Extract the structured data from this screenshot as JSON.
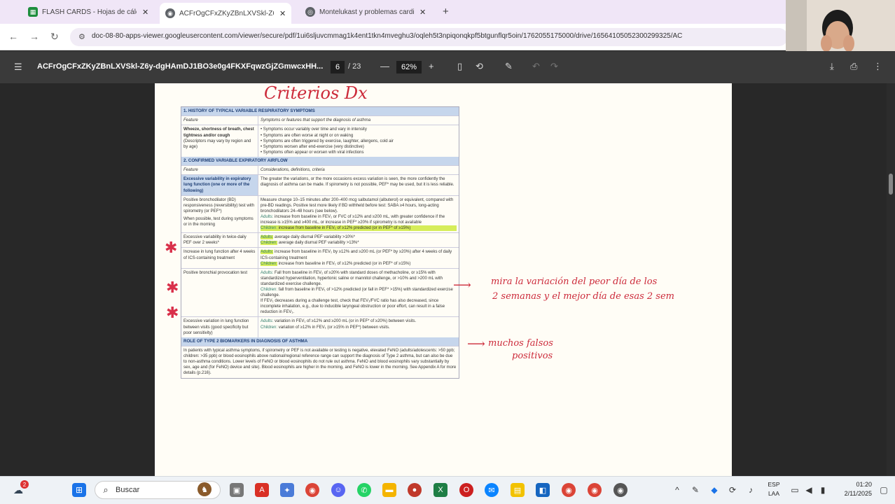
{
  "tabs": [
    {
      "title": "FLASH CARDS - Hojas de cálcu",
      "icon": "sheets-icon",
      "color": "#1e8e3e",
      "close": "✕"
    },
    {
      "title": "ACFrOgCFxZKyZBnLXVSkl-Z6y",
      "icon": "chrome-icon",
      "color": "#5f6368",
      "close": "✕"
    },
    {
      "title": "Montelukast y problemas cardi",
      "icon": "globe-icon",
      "color": "#5f6368",
      "close": "✕"
    }
  ],
  "new_tab": "+",
  "url": "doc-08-80-apps-viewer.googleusercontent.com/viewer/secure/pdf/1ui6sljuvcmmag1k4ent1tkn4mveghu3/oqleh5t3npiqonqkpf5btgunflqr5oin/1762055175000/drive/16564105052300299325/AC",
  "pdf": {
    "doc_name": "ACFrOgCFxZKyZBnLXVSkl-Z6y-dgHAmDJ1BO3e0g4FKXFqwzGjZGmwcxHH...",
    "page_current": "6",
    "page_total": "/ 23",
    "zoom": "62%"
  },
  "handwriting": {
    "title": "Criterios Dx",
    "note1_line1": "mira la variación del peor día de los",
    "note1_line2": "2 semanas y el mejor día de esas 2 sem",
    "note2_line1": "muchos falsos",
    "note2_line2": "positivos",
    "arrow": "⟶"
  },
  "table": {
    "s1": "1. HISTORY OF TYPICAL VARIABLE RESPIRATORY SYMPTOMS",
    "s1_head_feature": "Feature",
    "s1_head_sym": "Symptoms or features that support the diagnosis of asthma",
    "s1_left_bold": "Wheeze, shortness of breath, chest tightness and/or cough",
    "s1_left_sub": "(Descriptors may vary by region and by age)",
    "s1_b1": "• Symptoms occur variably over time and vary in intensity",
    "s1_b2": "• Symptoms are often worse at night or on waking",
    "s1_b3": "• Symptoms are often triggered by exercise, laughter, allergens, cold air",
    "s1_b4": "• Symptoms worsen after end-exercise (very distinctive)",
    "s1_b5": "• Symptoms often appear or worsen with viral infections",
    "s2": "2. CONFIRMED VARIABLE EXPIRATORY AIRFLOW",
    "s2_head_feature": "Feature",
    "s2_head_def": "Considerations, definitions, criteria",
    "r1_left": "Excessive variability in expiratory lung function (one or more of the following)",
    "r1_right": "The greater the variations, or the more occasions excess variation is seen, the more confidently the diagnosis of asthma can be made. If spirometry is not possible, PEF* may be used, but it is less reliable.",
    "r2_left": "Positive bronchodilator (BD) responsiveness (reversibility) test with spirometry (or PEF*)",
    "r2_left2": "When possible, test during symptoms or in the morning",
    "r2_right": "Measure change 10–15 minutes after 200–400 mcg salbutamol (albuterol) or equivalent, compared with pre-BD readings. Positive test more likely if BD withheld before test: SABA ≥4 hours, long-acting bronchodilators 24–48 hours (see below).",
    "r2_adults_label": "Adults:",
    "r2_adults": "increase from baseline in FEV₁ or FVC of ≥12% and ≥200 mL, with greater confidence if the increase is ≥15% and ≥400 mL, or increase in PEF* ≥20% if spirometry is not available",
    "r2_children_label": "Children:",
    "r2_children": "increase from baseline in FEV₁ of ≥12% predicted (or in PEF* of ≥15%)",
    "r3_left": "Excessive variability in twice-daily PEF over 2 weeks*",
    "r3_adults_label": "Adults:",
    "r3_adults": "average daily diurnal PEF variability >10%*",
    "r3_children_label": "Children:",
    "r3_children": "average daily diurnal PEF variability >13%*",
    "r4_left": "Increase in lung function after 4 weeks of ICS-containing treatment",
    "r4_adults_label": "Adults:",
    "r4_adults": "increase from baseline in FEV₁ by ≥12% and ≥200 mL (or PEF* by ≥20%) after 4 weeks of daily ICS-containing treatment",
    "r4_children_label": "Children:",
    "r4_children": "increase from baseline in FEV₁ of ≥12% predicted (or in PEF* of ≥15%)",
    "r5_left": "Positive bronchial provocation test",
    "r5_adults_label": "Adults:",
    "r5_adults": "Fall from baseline in FEV₁ of ≥20% with standard doses of methacholine, or ≥15% with standardized hyperventilation, hypertonic saline or mannitol challenge, or >10% and >200 mL with standardized exercise challenge.",
    "r5_children_label": "Children:",
    "r5_children": "fall from baseline in FEV₁ of >12% predicted (or fall in PEF* >15%) with standardized exercise challenge.",
    "r5_note": "If FEV₁ decreases during a challenge test, check that FEV₁/FVC ratio has also decreased, since incomplete inhalation, e.g., due to inducible laryngeal obstruction or poor effort, can result in a false reduction in FEV₁.",
    "r6_left": "Excessive variation in lung function between visits (good specificity but poor sensitivity)",
    "r6_adults_label": "Adults:",
    "r6_adults": "variation in FEV₁ of ≥12% and ≥200 mL (or in PEF* of ≥20%) between visits.",
    "r6_children_label": "Children:",
    "r6_children": "variation of ≥12% in FEV₁ (or ≥15% in PEF*) between visits.",
    "s3": "ROLE OF TYPE 2 BIOMARKERS IN DIAGNOSIS OF ASTHMA",
    "s3_text": "In patients with typical asthma symptoms, if spirometry or PEF is not available or testing is negative, elevated FeNO (adults/adolescents: >50 ppb; children: >35 ppb) or blood eosinophils above national/regional reference range can support the diagnosis of Type 2 asthma, but can also be due to non-asthma conditions. Lower levels of FeNO or blood eosinophils do not rule out asthma. FeNO and blood eosinophils vary substantially by sex, age and (for FeNO) device and site). Blood eosinophils are higher in the morning, and FeNO is lower in the morning. See Appendix A for more details (p.216)."
  },
  "taskbar": {
    "search_placeholder": "Buscar",
    "lang_line1": "ESP",
    "lang_line2": "LAA",
    "time": "01:20",
    "date": "2/11/2025",
    "badge": "2"
  }
}
